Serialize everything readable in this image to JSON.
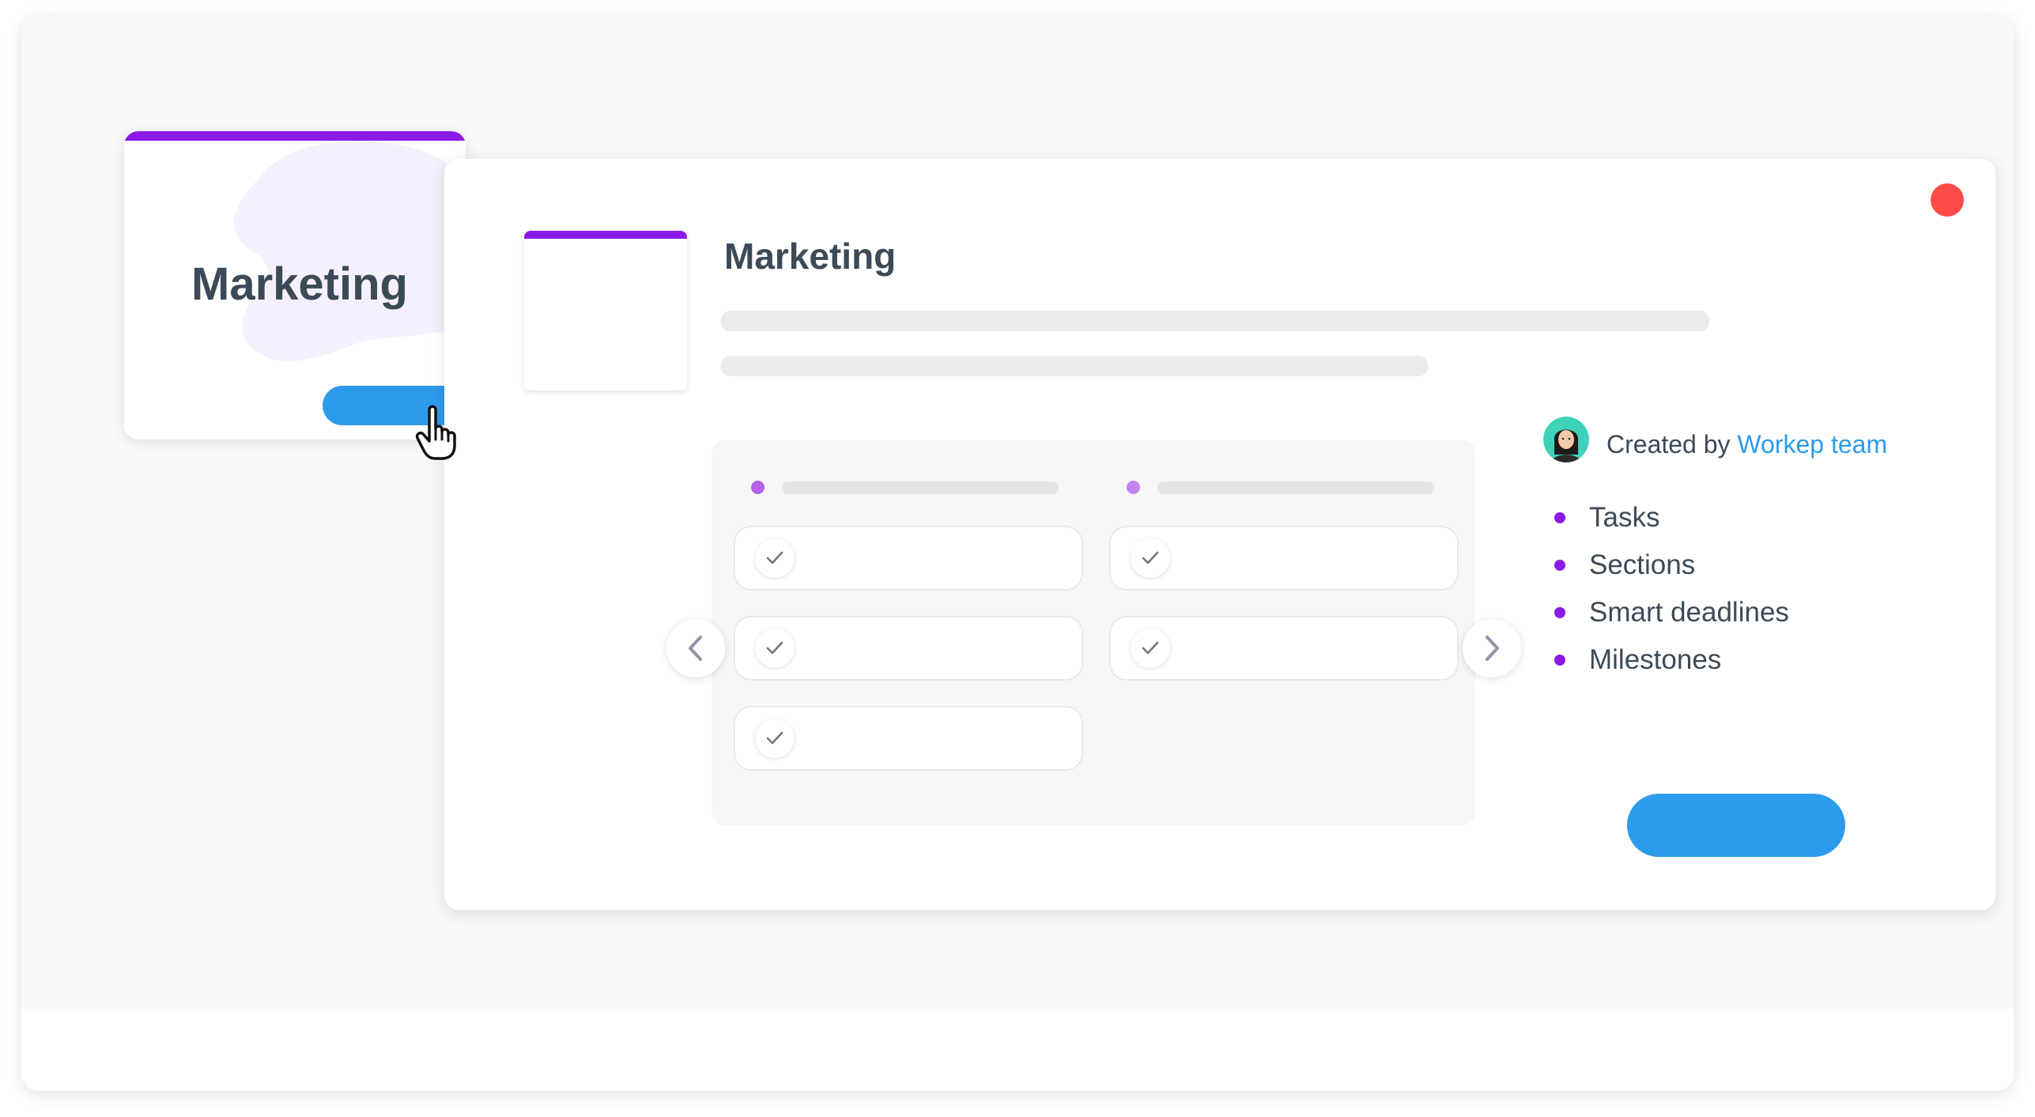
{
  "small_card": {
    "title": "Marketing",
    "accent_color": "#8a1ae6",
    "button_color": "#2d9bec"
  },
  "modal": {
    "title": "Marketing",
    "close_color": "#ff4a4a",
    "preview": {
      "columns": [
        {
          "dot_color": "#b561e8",
          "tasks": 3
        },
        {
          "dot_color": "#c384ee",
          "tasks": 2
        }
      ]
    },
    "created_by": {
      "prefix": "Created by",
      "author": "Workep team"
    },
    "features": [
      "Tasks",
      "Sections",
      "Smart deadlines",
      "Milestones"
    ],
    "primary_button_color": "#2d9bec"
  },
  "icons": {
    "close": "close-icon",
    "prev": "chevron-left-icon",
    "next": "chevron-right-icon",
    "check": "check-icon",
    "cursor": "hand-pointer-icon"
  }
}
